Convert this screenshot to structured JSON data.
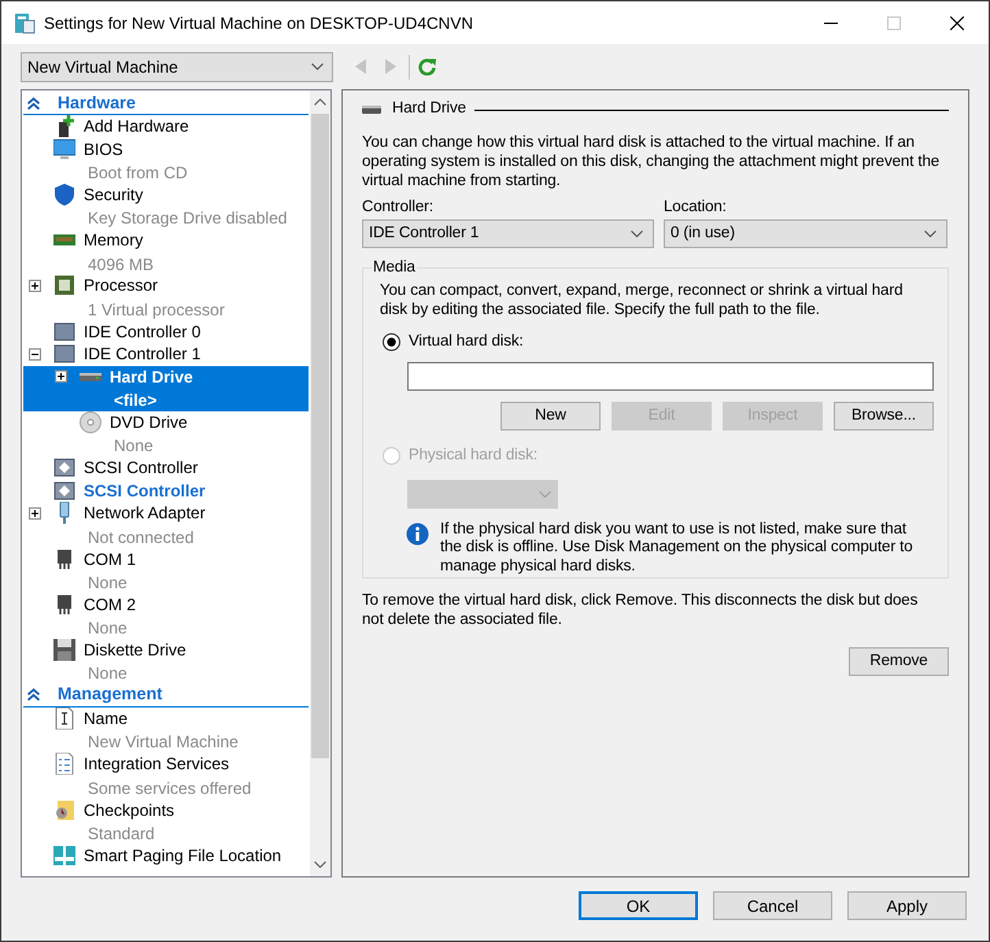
{
  "window": {
    "title": "Settings for New Virtual Machine on DESKTOP-UD4CNVN",
    "maximize_disabled": true
  },
  "vm_selector": {
    "value": "New Virtual Machine"
  },
  "toolbar": {
    "back_disabled": true,
    "forward_disabled": true
  },
  "tree": [
    {
      "title": "Hardware",
      "expanded": true,
      "items": [
        {
          "label": "Add Hardware",
          "selected": false,
          "highlighted": false
        },
        {
          "label": "BIOS",
          "detail": "Boot from CD",
          "selected": false,
          "highlighted": false
        },
        {
          "label": "Security",
          "detail": "Key Storage Drive disabled",
          "selected": false,
          "highlighted": false
        },
        {
          "label": "Memory",
          "detail": "4096 MB",
          "selected": false,
          "highlighted": false
        },
        {
          "label": "Processor",
          "detail": "1 Virtual processor",
          "selected": false,
          "highlighted": false,
          "expanded": false
        },
        {
          "label": "IDE Controller 0",
          "selected": false,
          "highlighted": false
        },
        {
          "label": "IDE Controller 1",
          "selected": false,
          "highlighted": false,
          "expanded": true,
          "children": [
            {
              "label": "Hard Drive",
              "detail": "<file>",
              "selected": true,
              "highlighted": false,
              "expanded": false
            },
            {
              "label": "DVD Drive",
              "detail": "None",
              "selected": false,
              "highlighted": false
            }
          ]
        },
        {
          "label": "SCSI Controller",
          "selected": false,
          "highlighted": false
        },
        {
          "label": "SCSI Controller",
          "selected": false,
          "highlighted": true
        },
        {
          "label": "Network Adapter",
          "detail": "Not connected",
          "selected": false,
          "highlighted": false,
          "expanded": false
        },
        {
          "label": "COM 1",
          "detail": "None",
          "selected": false,
          "highlighted": false
        },
        {
          "label": "COM 2",
          "detail": "None",
          "selected": false,
          "highlighted": false
        },
        {
          "label": "Diskette Drive",
          "detail": "None",
          "selected": false,
          "highlighted": false
        }
      ]
    },
    {
      "title": "Management",
      "expanded": true,
      "items": [
        {
          "label": "Name",
          "detail": "New Virtual Machine",
          "selected": false,
          "highlighted": false
        },
        {
          "label": "Integration Services",
          "detail": "Some services offered",
          "selected": false,
          "highlighted": false
        },
        {
          "label": "Checkpoints",
          "detail": "Standard",
          "selected": false,
          "highlighted": false
        },
        {
          "label": "Smart Paging File Location",
          "selected": false,
          "highlighted": false
        }
      ]
    }
  ],
  "panel": {
    "title": "Hard Drive",
    "intro": "You can change how this virtual hard disk is attached to the virtual machine. If an operating system is installed on this disk, changing the attachment might prevent the virtual machine from starting.",
    "controller": {
      "label": "Controller:",
      "value": "IDE Controller 1"
    },
    "location": {
      "label": "Location:",
      "value": "0 (in use)"
    },
    "media": {
      "title": "Media",
      "text": "You can compact, convert, expand, merge, reconnect or shrink a virtual hard disk by editing the associated file. Specify the full path to the file.",
      "virtual": {
        "label": "Virtual hard disk:",
        "selected": true,
        "disabled": false
      },
      "buttons": [
        {
          "label": "New",
          "disabled": false
        },
        {
          "label": "Edit",
          "disabled": true
        },
        {
          "label": "Inspect",
          "disabled": true
        },
        {
          "label": "Browse...",
          "disabled": false
        }
      ],
      "physical": {
        "label": "Physical hard disk:",
        "selected": false,
        "disabled": true
      },
      "info": "If the physical hard disk you want to use is not listed, make sure that the disk is offline. Use Disk Management on the physical computer to manage physical hard disks."
    },
    "remove_text": "To remove the virtual hard disk, click Remove. This disconnects the disk but does not delete the associated file.",
    "remove_button": "Remove"
  },
  "footer": [
    {
      "label": "OK",
      "default": true
    },
    {
      "label": "Cancel",
      "default": false
    },
    {
      "label": "Apply",
      "default": false
    }
  ]
}
